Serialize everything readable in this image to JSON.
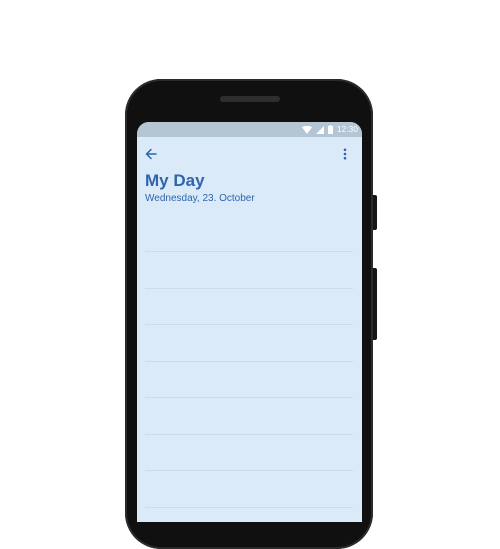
{
  "status_bar": {
    "time": "12:30",
    "icons": [
      "wifi-icon",
      "cell-signal-icon",
      "battery-icon"
    ]
  },
  "toolbar": {
    "back_icon": "arrow-left-icon",
    "menu_icon": "more-vertical-icon"
  },
  "header": {
    "title": "My Day",
    "date": "Wednesday, 23. October"
  },
  "colors": {
    "accent": "#2f65aa",
    "screen_background": "#dbeaf8",
    "status_bar": "#b4c5d3",
    "phone_body": "#101010"
  },
  "task_list": {
    "items": []
  }
}
